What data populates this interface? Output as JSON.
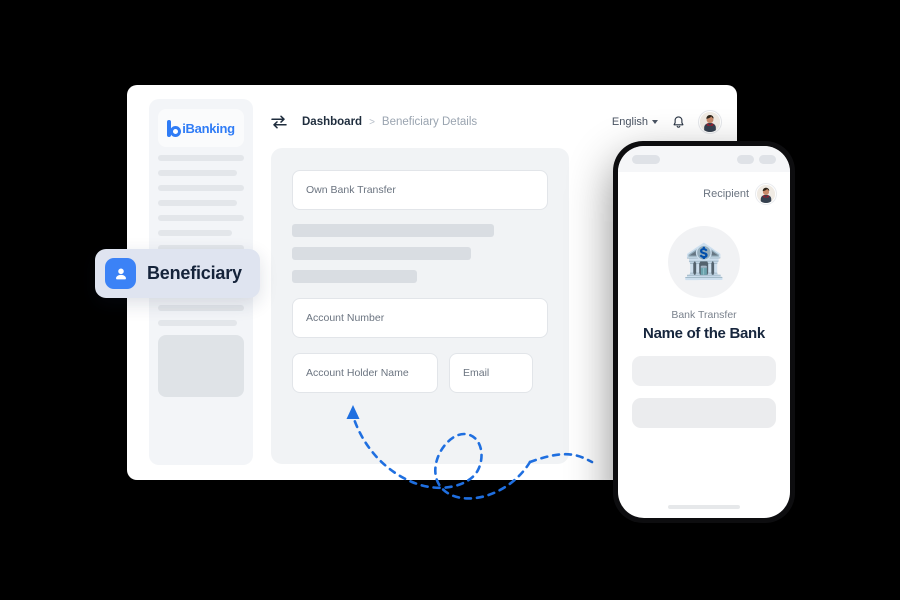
{
  "app": {
    "logo_text": "iBanking",
    "logo_icon": "b-mark-logo-icon"
  },
  "breadcrumb": {
    "swap_icon": "transfer-arrows-icon",
    "parent": "Dashboard",
    "separator": ">",
    "current": "Beneficiary Details"
  },
  "topbar": {
    "language": "English",
    "language_caret_icon": "chevron-down-icon",
    "bell_icon": "notification-bell-icon",
    "avatar_icon": "user-avatar"
  },
  "form": {
    "transfer_type": "Own Bank Transfer",
    "account_number": "Account Number",
    "account_holder_name": "Account Holder Name",
    "email": "Email"
  },
  "badge": {
    "label": "Beneficiary",
    "icon": "person-contact-icon"
  },
  "phone": {
    "recipient_label": "Recipient",
    "recipient_avatar_icon": "user-avatar",
    "bank_icon": "🏦",
    "transfer_label": "Bank Transfer",
    "bank_name": "Name of the Bank"
  },
  "colors": {
    "brand_blue": "#2f7cf6",
    "badge_icon_blue": "#3b82f6",
    "arrow_blue": "#1f6fe0",
    "canvas_black": "#000000",
    "panel_white": "#ffffff",
    "card_gray": "#f1f3f5",
    "skeleton_gray": "#e3e6ea"
  }
}
